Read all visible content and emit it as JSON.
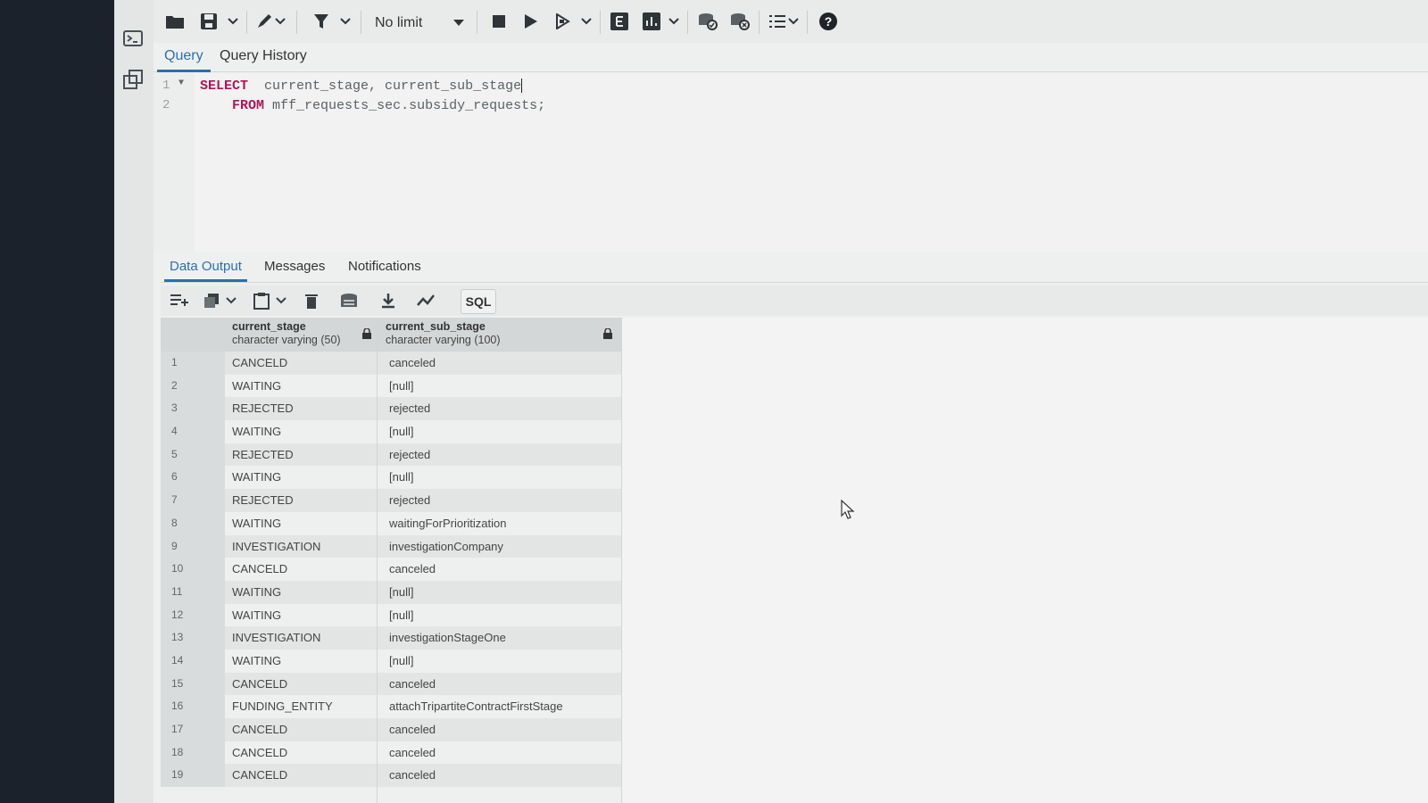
{
  "toolbar": {
    "limit_label": "No limit",
    "icons": [
      "folder-icon",
      "save-icon",
      "chevron-down-icon",
      "pencil-icon",
      "filter-icon",
      "stop-icon",
      "play-icon",
      "play-step-icon",
      "explain-icon",
      "explain-analyze-icon",
      "commit-icon",
      "rollback-icon",
      "macros-icon",
      "help-icon"
    ]
  },
  "editor_tabs": [
    {
      "label": "Query"
    },
    {
      "label": "Query History"
    }
  ],
  "editor": {
    "lines": [
      {
        "num": "1",
        "keyword": "SELECT",
        "text": "current_stage, current_sub_stage"
      },
      {
        "num": "2",
        "keyword": "FROM",
        "text": "mff_requests_sec.subsidy_requests;"
      }
    ]
  },
  "result_tabs": [
    {
      "label": "Data Output"
    },
    {
      "label": "Messages"
    },
    {
      "label": "Notifications"
    }
  ],
  "result_toolbar": {
    "sql_label": "SQL"
  },
  "grid": {
    "columns": [
      {
        "name": "current_stage",
        "type": "character varying (50)"
      },
      {
        "name": "current_sub_stage",
        "type": "character varying (100)"
      }
    ],
    "rows": [
      [
        "1",
        "CANCELD",
        "canceled"
      ],
      [
        "2",
        "WAITING",
        "[null]"
      ],
      [
        "3",
        "REJECTED",
        "rejected"
      ],
      [
        "4",
        "WAITING",
        "[null]"
      ],
      [
        "5",
        "REJECTED",
        "rejected"
      ],
      [
        "6",
        "WAITING",
        "[null]"
      ],
      [
        "7",
        "REJECTED",
        "rejected"
      ],
      [
        "8",
        "WAITING",
        "waitingForPrioritization"
      ],
      [
        "9",
        "INVESTIGATION",
        "investigationCompany"
      ],
      [
        "10",
        "CANCELD",
        "canceled"
      ],
      [
        "11",
        "WAITING",
        "[null]"
      ],
      [
        "12",
        "WAITING",
        "[null]"
      ],
      [
        "13",
        "INVESTIGATION",
        "investigationStageOne"
      ],
      [
        "14",
        "WAITING",
        "[null]"
      ],
      [
        "15",
        "CANCELD",
        "canceled"
      ],
      [
        "16",
        "FUNDING_ENTITY",
        "attachTripartiteContractFirstStage"
      ],
      [
        "17",
        "CANCELD",
        "canceled"
      ],
      [
        "18",
        "CANCELD",
        "canceled"
      ],
      [
        "19",
        "CANCELD",
        "canceled"
      ]
    ]
  }
}
